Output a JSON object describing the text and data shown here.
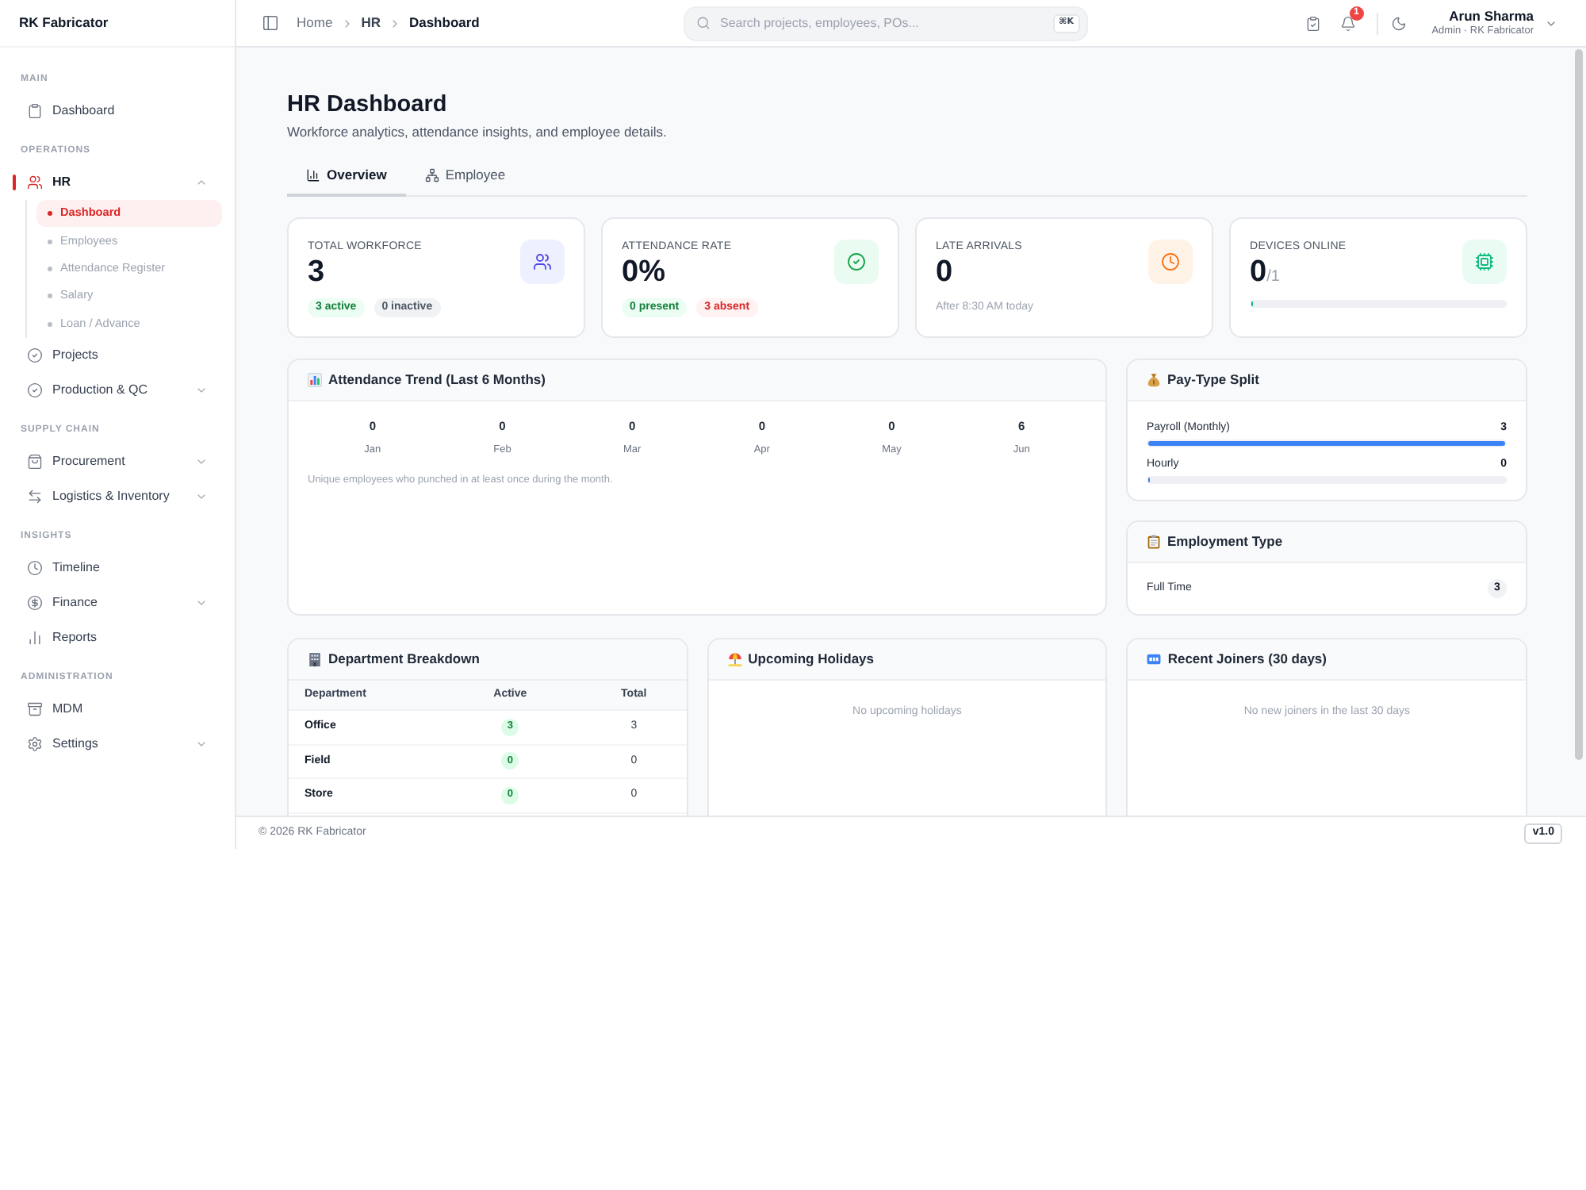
{
  "sidebar": {
    "brand": "RK Fabricator",
    "sections": [
      {
        "title": "MAIN",
        "items": [
          {
            "label": "Dashboard",
            "kind": "link",
            "selected": false
          }
        ]
      },
      {
        "title": "OPERATIONS",
        "items": [
          {
            "label": "HR",
            "kind": "group",
            "selected": true,
            "expanded": true,
            "children": [
              {
                "label": "Dashboard",
                "selected": true
              },
              {
                "label": "Employees",
                "selected": false
              },
              {
                "label": "Attendance Register",
                "selected": false
              },
              {
                "label": "Salary",
                "selected": false
              },
              {
                "label": "Loan / Advance",
                "selected": false
              }
            ]
          },
          {
            "label": "Projects",
            "kind": "link",
            "selected": false
          },
          {
            "label": "Production & QC",
            "kind": "group",
            "selected": false,
            "expanded": false
          }
        ]
      },
      {
        "title": "SUPPLY CHAIN",
        "items": [
          {
            "label": "Procurement",
            "kind": "group",
            "selected": false,
            "expanded": false
          },
          {
            "label": "Logistics & Inventory",
            "kind": "group",
            "selected": false,
            "expanded": false
          }
        ]
      },
      {
        "title": "INSIGHTS",
        "items": [
          {
            "label": "Timeline",
            "kind": "link",
            "selected": false
          },
          {
            "label": "Finance",
            "kind": "group",
            "selected": false,
            "expanded": false
          },
          {
            "label": "Reports",
            "kind": "link",
            "selected": false
          }
        ]
      },
      {
        "title": "ADMINISTRATION",
        "items": [
          {
            "label": "MDM",
            "kind": "link",
            "selected": false
          },
          {
            "label": "Settings",
            "kind": "group",
            "selected": false,
            "expanded": false
          }
        ]
      }
    ]
  },
  "header": {
    "breadcrumb": [
      "Home",
      "HR",
      "Dashboard"
    ],
    "search": {
      "placeholder": "Search projects, employees, POs...",
      "shortcut": "⌘K"
    },
    "notification_count": "1",
    "user": {
      "name": "Arun Sharma",
      "role": "Admin · RK Fabricator"
    }
  },
  "page": {
    "title": "HR Dashboard",
    "subtitle": "Workforce analytics, attendance insights, and employee details.",
    "tabs": [
      {
        "label": "Overview",
        "selected": true
      },
      {
        "label": "Employee",
        "selected": false
      }
    ]
  },
  "stats": [
    {
      "label": "TOTAL WORKFORCE",
      "value": "3",
      "kind": "badges",
      "badges": [
        {
          "text": "3 active",
          "kind": "success"
        },
        {
          "text": "0 inactive",
          "kind": "neutral"
        }
      ]
    },
    {
      "label": "ATTENDANCE RATE",
      "value": "0%",
      "kind": "badges",
      "badges": [
        {
          "text": "0 present",
          "kind": "success"
        },
        {
          "text": "3 absent",
          "kind": "danger"
        }
      ]
    },
    {
      "label": "LATE ARRIVALS",
      "value": "0",
      "kind": "note",
      "note": "After 8:30 AM today"
    },
    {
      "label": "DEVICES ONLINE",
      "value": "0",
      "total": "/1",
      "kind": "meter",
      "level": 0
    }
  ],
  "attendance_trend": {
    "title": "Attendance Trend (Last 6 Months)",
    "months": [
      {
        "value": "0",
        "label": "Jan"
      },
      {
        "value": "0",
        "label": "Feb"
      },
      {
        "value": "0",
        "label": "Mar"
      },
      {
        "value": "0",
        "label": "Apr"
      },
      {
        "value": "0",
        "label": "May"
      },
      {
        "value": "6",
        "label": "Jun"
      }
    ],
    "note": "Unique employees who punched in at least once during the month."
  },
  "pay_type_split": {
    "title": "Pay-Type Split",
    "rows": [
      {
        "label": "Payroll (Monthly)",
        "value": "3",
        "level": 1
      },
      {
        "label": "Hourly",
        "value": "0",
        "level": 0
      }
    ]
  },
  "employment_type": {
    "title": "Employment Type",
    "rows": [
      {
        "label": "Full Time",
        "count": "3"
      }
    ]
  },
  "department_breakdown": {
    "title": "Department Breakdown",
    "columns": [
      "Department",
      "Active",
      "Total"
    ],
    "rows": [
      {
        "department": "Office",
        "active": "3",
        "total": "3"
      },
      {
        "department": "Field",
        "active": "0",
        "total": "0"
      },
      {
        "department": "Store",
        "active": "0",
        "total": "0"
      }
    ]
  },
  "upcoming_holidays": {
    "title": "Upcoming Holidays",
    "empty_text": "No upcoming holidays"
  },
  "recent_joiners": {
    "title": "Recent Joiners (30 days)",
    "empty_text": "No new joiners in the last 30 days"
  },
  "footer": {
    "copyright": "© 2026 RK Fabricator",
    "version": "v1.0"
  }
}
